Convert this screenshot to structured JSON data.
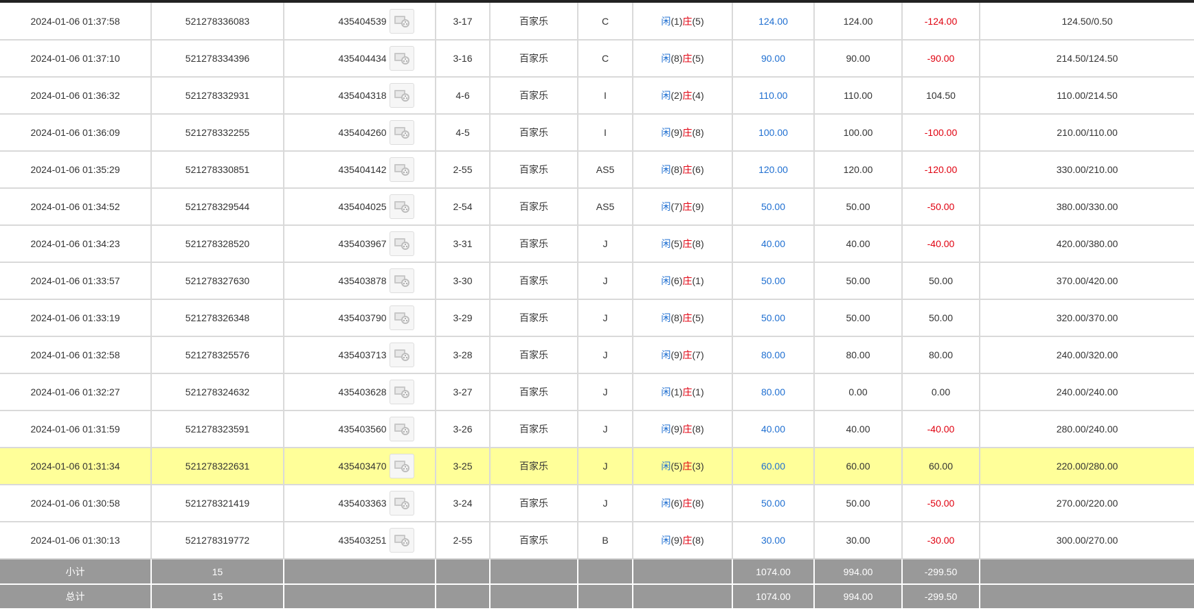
{
  "colors": {
    "payout_blue": "#1f6fd1",
    "loss_red": "#e0000f",
    "highlight_row": "#ffff99",
    "summary_bg": "#999999"
  },
  "icons": {
    "video": "video-replay-icon"
  },
  "rows": [
    {
      "time": "2024-01-06 01:37:58",
      "order": "521278336083",
      "round": "435404539",
      "shoe": "3-17",
      "game": "百家乐",
      "table": "C",
      "player_label": "闲",
      "player_score": "(1)",
      "banker_label": "庄",
      "banker_score": "(5)",
      "bet": "124.00",
      "valid": "124.00",
      "win": "-124.00",
      "win_neg": true,
      "balance": "124.50/0.50"
    },
    {
      "time": "2024-01-06 01:37:10",
      "order": "521278334396",
      "round": "435404434",
      "shoe": "3-16",
      "game": "百家乐",
      "table": "C",
      "player_label": "闲",
      "player_score": "(8)",
      "banker_label": "庄",
      "banker_score": "(5)",
      "bet": "90.00",
      "valid": "90.00",
      "win": "-90.00",
      "win_neg": true,
      "balance": "214.50/124.50"
    },
    {
      "time": "2024-01-06 01:36:32",
      "order": "521278332931",
      "round": "435404318",
      "shoe": "4-6",
      "game": "百家乐",
      "table": "I",
      "player_label": "闲",
      "player_score": "(2)",
      "banker_label": "庄",
      "banker_score": "(4)",
      "bet": "110.00",
      "valid": "110.00",
      "win": "104.50",
      "win_neg": false,
      "balance": "110.00/214.50"
    },
    {
      "time": "2024-01-06 01:36:09",
      "order": "521278332255",
      "round": "435404260",
      "shoe": "4-5",
      "game": "百家乐",
      "table": "I",
      "player_label": "闲",
      "player_score": "(9)",
      "banker_label": "庄",
      "banker_score": "(8)",
      "bet": "100.00",
      "valid": "100.00",
      "win": "-100.00",
      "win_neg": true,
      "balance": "210.00/110.00"
    },
    {
      "time": "2024-01-06 01:35:29",
      "order": "521278330851",
      "round": "435404142",
      "shoe": "2-55",
      "game": "百家乐",
      "table": "AS5",
      "player_label": "闲",
      "player_score": "(8)",
      "banker_label": "庄",
      "banker_score": "(6)",
      "bet": "120.00",
      "valid": "120.00",
      "win": "-120.00",
      "win_neg": true,
      "balance": "330.00/210.00"
    },
    {
      "time": "2024-01-06 01:34:52",
      "order": "521278329544",
      "round": "435404025",
      "shoe": "2-54",
      "game": "百家乐",
      "table": "AS5",
      "player_label": "闲",
      "player_score": "(7)",
      "banker_label": "庄",
      "banker_score": "(9)",
      "bet": "50.00",
      "valid": "50.00",
      "win": "-50.00",
      "win_neg": true,
      "balance": "380.00/330.00"
    },
    {
      "time": "2024-01-06 01:34:23",
      "order": "521278328520",
      "round": "435403967",
      "shoe": "3-31",
      "game": "百家乐",
      "table": "J",
      "player_label": "闲",
      "player_score": "(5)",
      "banker_label": "庄",
      "banker_score": "(8)",
      "bet": "40.00",
      "valid": "40.00",
      "win": "-40.00",
      "win_neg": true,
      "balance": "420.00/380.00"
    },
    {
      "time": "2024-01-06 01:33:57",
      "order": "521278327630",
      "round": "435403878",
      "shoe": "3-30",
      "game": "百家乐",
      "table": "J",
      "player_label": "闲",
      "player_score": "(6)",
      "banker_label": "庄",
      "banker_score": "(1)",
      "bet": "50.00",
      "valid": "50.00",
      "win": "50.00",
      "win_neg": false,
      "balance": "370.00/420.00"
    },
    {
      "time": "2024-01-06 01:33:19",
      "order": "521278326348",
      "round": "435403790",
      "shoe": "3-29",
      "game": "百家乐",
      "table": "J",
      "player_label": "闲",
      "player_score": "(8)",
      "banker_label": "庄",
      "banker_score": "(5)",
      "bet": "50.00",
      "valid": "50.00",
      "win": "50.00",
      "win_neg": false,
      "balance": "320.00/370.00"
    },
    {
      "time": "2024-01-06 01:32:58",
      "order": "521278325576",
      "round": "435403713",
      "shoe": "3-28",
      "game": "百家乐",
      "table": "J",
      "player_label": "闲",
      "player_score": "(9)",
      "banker_label": "庄",
      "banker_score": "(7)",
      "bet": "80.00",
      "valid": "80.00",
      "win": "80.00",
      "win_neg": false,
      "balance": "240.00/320.00"
    },
    {
      "time": "2024-01-06 01:32:27",
      "order": "521278324632",
      "round": "435403628",
      "shoe": "3-27",
      "game": "百家乐",
      "table": "J",
      "player_label": "闲",
      "player_score": "(1)",
      "banker_label": "庄",
      "banker_score": "(1)",
      "bet": "80.00",
      "valid": "0.00",
      "win": "0.00",
      "win_neg": false,
      "balance": "240.00/240.00"
    },
    {
      "time": "2024-01-06 01:31:59",
      "order": "521278323591",
      "round": "435403560",
      "shoe": "3-26",
      "game": "百家乐",
      "table": "J",
      "player_label": "闲",
      "player_score": "(9)",
      "banker_label": "庄",
      "banker_score": "(8)",
      "bet": "40.00",
      "valid": "40.00",
      "win": "-40.00",
      "win_neg": true,
      "balance": "280.00/240.00"
    },
    {
      "time": "2024-01-06 01:31:34",
      "order": "521278322631",
      "round": "435403470",
      "shoe": "3-25",
      "game": "百家乐",
      "table": "J",
      "player_label": "闲",
      "player_score": "(5)",
      "banker_label": "庄",
      "banker_score": "(3)",
      "bet": "60.00",
      "valid": "60.00",
      "win": "60.00",
      "win_neg": false,
      "balance": "220.00/280.00",
      "highlight": true
    },
    {
      "time": "2024-01-06 01:30:58",
      "order": "521278321419",
      "round": "435403363",
      "shoe": "3-24",
      "game": "百家乐",
      "table": "J",
      "player_label": "闲",
      "player_score": "(6)",
      "banker_label": "庄",
      "banker_score": "(8)",
      "bet": "50.00",
      "valid": "50.00",
      "win": "-50.00",
      "win_neg": true,
      "balance": "270.00/220.00"
    },
    {
      "time": "2024-01-06 01:30:13",
      "order": "521278319772",
      "round": "435403251",
      "shoe": "2-55",
      "game": "百家乐",
      "table": "B",
      "player_label": "闲",
      "player_score": "(9)",
      "banker_label": "庄",
      "banker_score": "(8)",
      "bet": "30.00",
      "valid": "30.00",
      "win": "-30.00",
      "win_neg": true,
      "balance": "300.00/270.00"
    }
  ],
  "subtotal": {
    "label": "小计",
    "count": "15",
    "bet": "1074.00",
    "valid": "994.00",
    "win": "-299.50"
  },
  "total": {
    "label": "总计",
    "count": "15",
    "bet": "1074.00",
    "valid": "994.00",
    "win": "-299.50"
  }
}
